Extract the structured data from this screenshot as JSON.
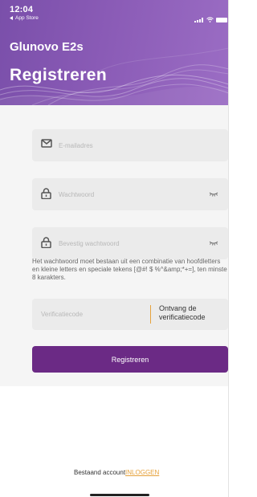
{
  "status_bar": {
    "time": "12:04",
    "back_app": "App Store",
    "back_icon": "back-triangle-icon"
  },
  "header": {
    "app_name": "Glunovo E2s",
    "title": "Registreren",
    "colors": {
      "gradient_start": "#7a4faa",
      "gradient_end": "#9b6dc4"
    }
  },
  "form": {
    "email": {
      "placeholder": "E-mailadres",
      "icon": "mail-icon"
    },
    "password": {
      "placeholder": "Wachtwoord",
      "icon": "lock-icon",
      "toggle_icon": "eye-closed-icon"
    },
    "confirm_password": {
      "placeholder": "Bevestig wachtwoord",
      "icon": "lock-icon",
      "toggle_icon": "eye-closed-icon"
    },
    "password_hint": "Het wachtwoord moet bestaan uit een combinatie van hoofdletters en kleine letters en speciale tekens [@#! $ %^&amp;*+=], ten minste 8 karakters.",
    "verification": {
      "placeholder": "Verificatiecode",
      "send_button": "Ontvang de verificatiecode"
    },
    "submit_label": "Registreren",
    "colors": {
      "button": "#6b2a85",
      "accent": "#e6a23c",
      "field_bg": "#ebebeb"
    }
  },
  "footer": {
    "existing_account": "Bestaand account",
    "login_link": "INLOGGEN"
  }
}
